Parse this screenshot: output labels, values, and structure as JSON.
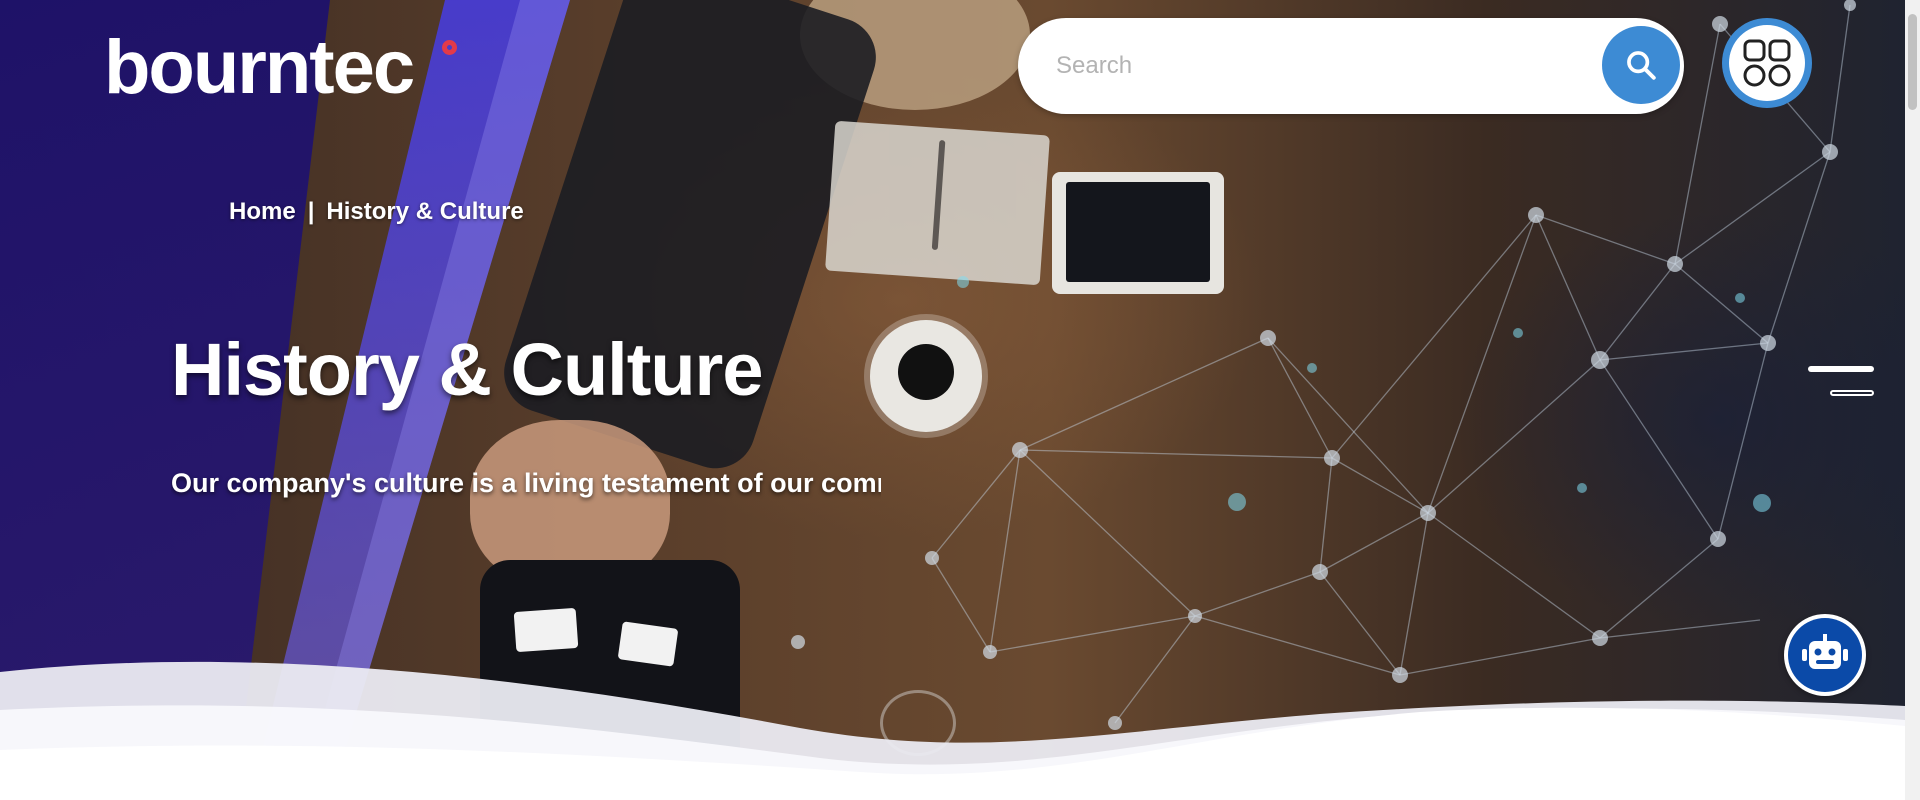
{
  "brand": {
    "name": "bourntec"
  },
  "search": {
    "placeholder": "Search"
  },
  "breadcrumb": {
    "home": "Home",
    "separator": "|",
    "current": "History & Culture"
  },
  "hero": {
    "title": "History & Culture",
    "subtitle": "Our company's culture is a living testament of our commitment"
  },
  "icons": {
    "search": "search-icon",
    "apps": "apps-grid-icon",
    "menu": "hamburger-menu-icon",
    "chatbot": "robot-icon"
  },
  "colors": {
    "accent_blue": "#3d8bd4",
    "chatbot_blue": "#0b4aa8",
    "logo_dot": "#e23a4a",
    "brand_purple": "#2b1a8f"
  }
}
